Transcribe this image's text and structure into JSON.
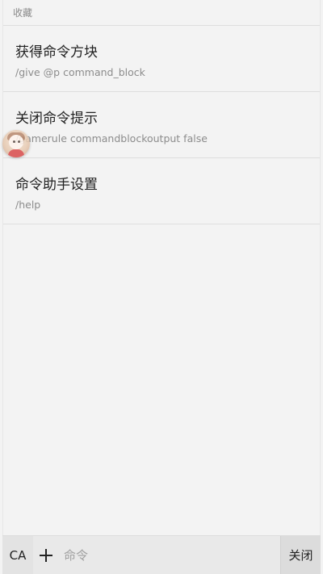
{
  "section": {
    "title": "收藏"
  },
  "favorites": [
    {
      "title": "获得命令方块",
      "command": "/give @p command_block"
    },
    {
      "title": "关闭命令提示",
      "command": "/gamerule commandblockoutput false"
    },
    {
      "title": "命令助手设置",
      "command": "/help"
    }
  ],
  "floating_avatar": {
    "icon": "anime-avatar-icon"
  },
  "bottom_bar": {
    "ca_label": "CA",
    "add_icon": "plus-icon",
    "input_placeholder": "命令",
    "input_value": "",
    "close_label": "关闭"
  }
}
